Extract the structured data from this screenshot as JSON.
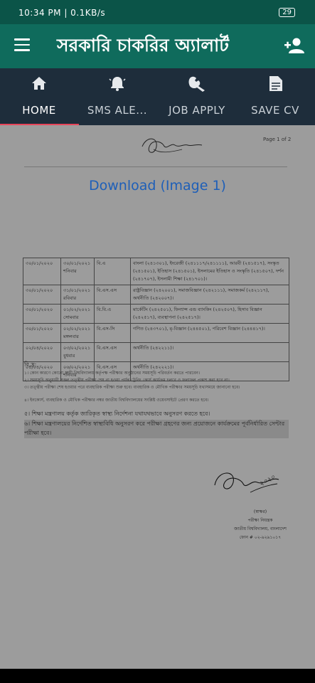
{
  "status": {
    "time": "10:34 PM",
    "speed": "0.1KB/s",
    "battery": "29"
  },
  "appbar": {
    "title": "সরকারি চাকরির অ্যালার্ট"
  },
  "tabs": [
    {
      "label": "HOME",
      "icon": "home-icon"
    },
    {
      "label": "SMS ALE...",
      "icon": "bell-icon"
    },
    {
      "label": "JOB APPLY",
      "icon": "wrench-icon"
    },
    {
      "label": "SAVE CV",
      "icon": "document-icon"
    }
  ],
  "document": {
    "page_number": "Page 1 of 2",
    "download_link": "Download (Image 1)",
    "rows": [
      {
        "date": "৩০/০১/২০২০",
        "exam_date": "৩০/০১/২০২১ শনিবার",
        "course": "বি.এ",
        "subjects": "বাংলা (২৪১৩০১), ইংরেজী (২৪১১১৭/২৪১১১১), আরবী (২৪১৫১৭), সংস্কৃত (২৪১৫০১), ইতিহাস (২৪১৫০১), ইসলামের ইতিহাস ও সংস্কৃতি (২৪১৫০৭), দর্শন (২৪১৭০৭), ইসলামী শিক্ষা (২৪১৭০১)।"
      },
      {
        "date": "৩০/০১/২০২০",
        "exam_date": "৩১/০১/২০২১ রবিবার",
        "course": "বি.এস.এস",
        "subjects": "রাষ্ট্রবিজ্ঞান (২৪২০০১), সমাজবিজ্ঞান (২৪২১১১), সমাজকর্ম (২৪২১১৭), অর্থনীতি (২৪২০০৭)।"
      },
      {
        "date": "৩০/০১/২০২০",
        "exam_date": "০১/০২/২০২১ সোমবার",
        "course": "বি.বি.এ",
        "subjects": "মার্কেটিং (২৪২৫০১), ফিন্যান্স এন্ড ব্যাংকিং (২৪২৫০৭), হিসাব বিজ্ঞান (২৪২৫১৭), ব্যবস্থাপনা (২৪২৫১৭)।"
      },
      {
        "date": "৩০/০১/২০২০",
        "exam_date": "০২/০২/২০২১ মঙ্গলবার",
        "course": "বি.এস-সি",
        "subjects": "গণিত (২৪৩৭০১), মৃ-বিজ্ঞান (২৪৪৫০১), পরিবেশ বিজ্ঞান (২৪৪৪১৭)।"
      },
      {
        "date": "০২/০৪/২০২০",
        "exam_date": "০৩/০২/২০২১ বুধবার",
        "course": "বি.এস.এস",
        "subjects": "অর্থনীতি (২৪২২১১)।"
      },
      {
        "date": "০৪/০৪/২০২০",
        "exam_date": "০৬/০২/২০২১ শনিবার",
        "course": "বি.এস.এস",
        "subjects": "অর্থনীতি (২৪২২২১)।"
      }
    ],
    "notes_heading": "বি.দ্র:",
    "notes": [
      "১। কোন কারণে কোনো স্থায়ী বিশ্ববিদ্যালয় কর্তৃপক্ষ পরীক্ষার অনুষ্ঠানের সময়সূচি পরিবর্তন করতে পারবেন।",
      "২। সময়সূচি অনুযায়ী সকল তত্ত্বীয় পরীক্ষা শেষ না হওয়া পর্যন্ত ট্রেনিং কোর্স কার্যক্রম চলবে ও ফলাফল প্রকাশ করা হবে না।",
      "৩। তত্ত্বীয় পরীক্ষা শেষ হওয়ার পরে ব্যবহারিক পরীক্ষা শুরু হবে। ব্যবহারিক ও মৌখিক পরীক্ষার সময়সূচি যথাসময়ে জানানো হবে।",
      "৪। ইনকোর্স, ব্যবহারিক ও মৌখিক পরীক্ষার নম্বর জাতীয় বিশ্ববিদ্যালয়ের সংশ্লিষ্ট ওয়েবসাইটে প্রেরণ করতে হবে।"
    ],
    "note_5": "৫। শিক্ষা মন্ত্রণালয় কর্তৃক জারিকৃত স্বাস্থ্য নির্দেশনা যথাযথভাবে অনুসরণ করতে হবে।",
    "note_6": "৬। শিক্ষা মন্ত্রণালয়ের নির্দেশিত স্বাস্থ্যবিধি অনুসরণ করে পরীক্ষা গ্রহণের জন্য প্রয়োজনে কার্যক্রমের পূর্বনির্ধারিত সেন্টার পরীক্ষা হবে।",
    "signature_date": "২০২০",
    "signatory": [
      "(স্বাক্ষর)",
      "পরীক্ষা নিয়ন্ত্রক",
      "জাতীয় বিশ্ববিদ্যালয়, বাংলাদেশ",
      "ফোন # ০২-৯২৯১০১৭"
    ]
  }
}
